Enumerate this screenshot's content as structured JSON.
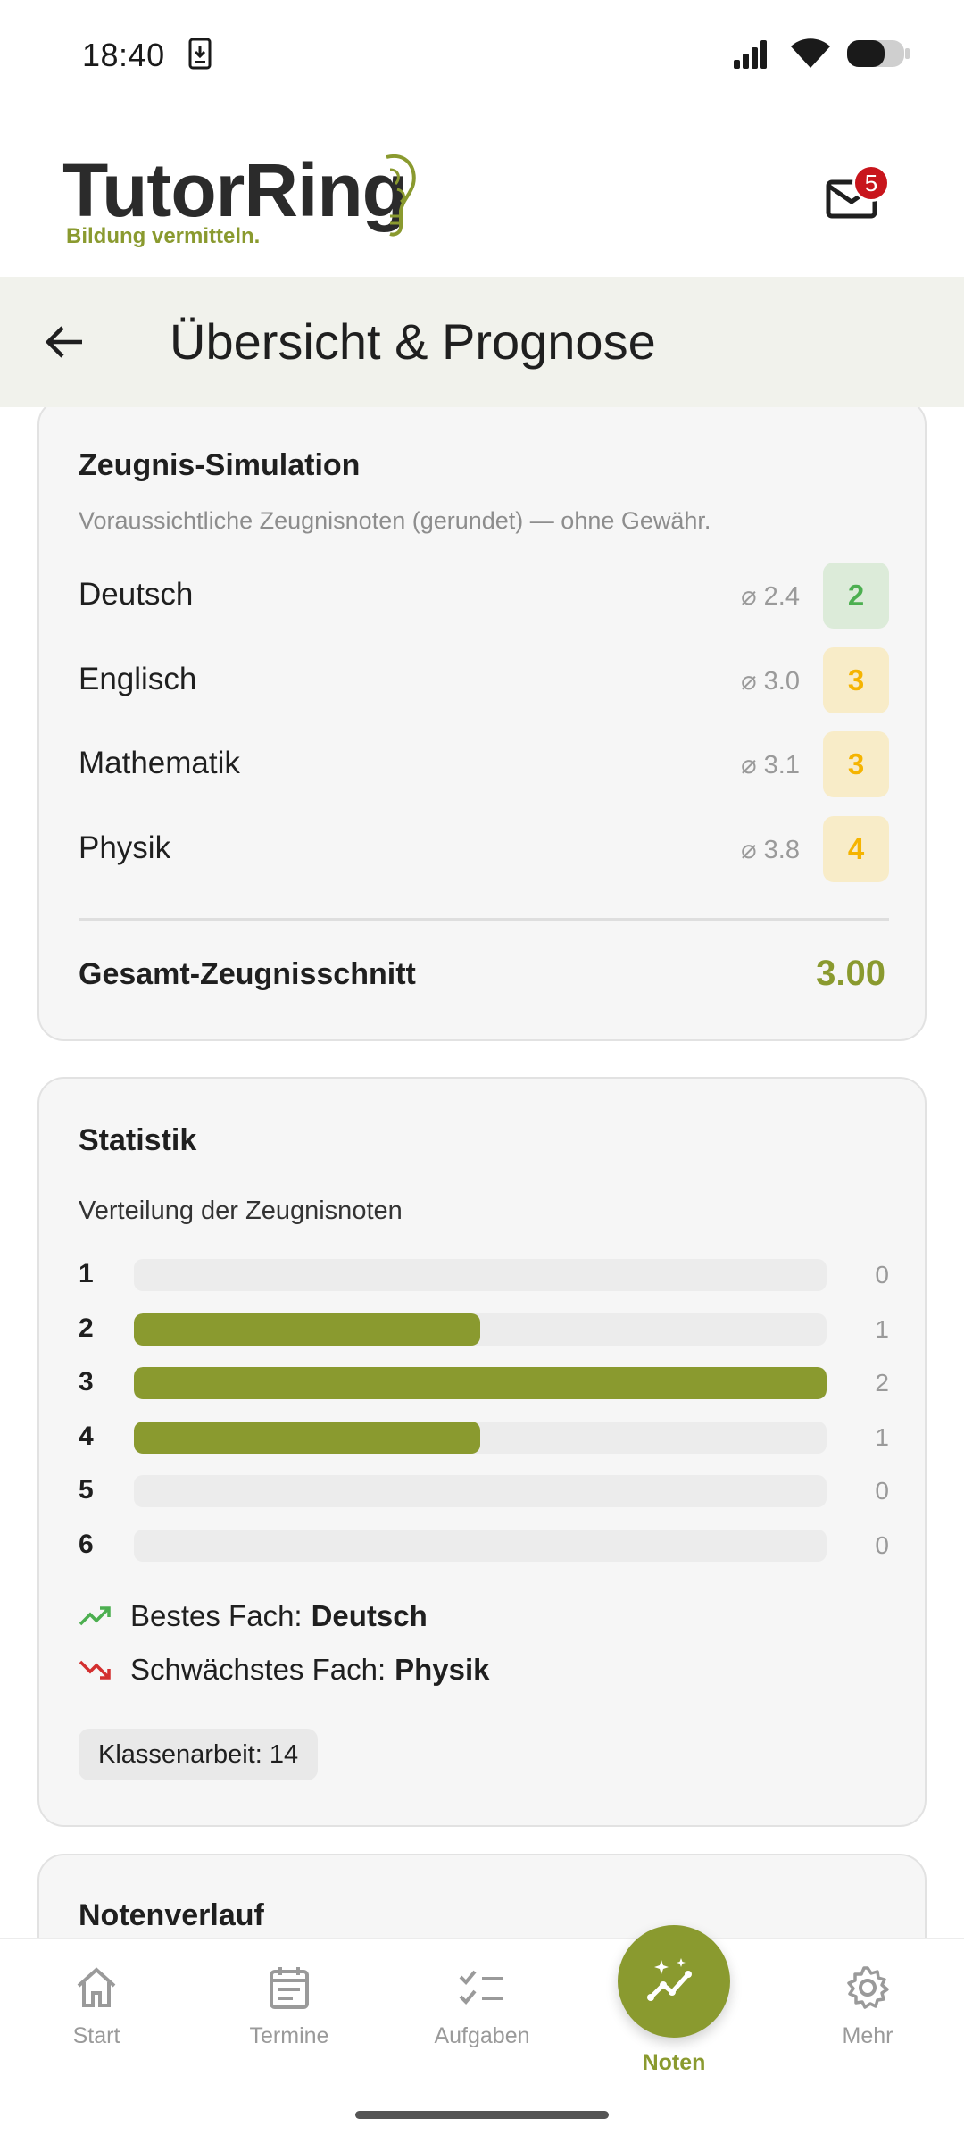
{
  "status_bar": {
    "time": "18:40"
  },
  "header": {
    "logo_title": "TutorRing",
    "logo_subtitle": "Bildung vermitteln.",
    "mail_badge": "5"
  },
  "title_bar": {
    "title": "Übersicht & Prognose"
  },
  "simulation": {
    "title": "Zeugnis-Simulation",
    "subtitle": "Voraussichtliche Zeugnisnoten (gerundet) — ohne Gewähr.",
    "subjects": [
      {
        "name": "Deutsch",
        "avg": "⌀ 2.4",
        "grade": "2"
      },
      {
        "name": "Englisch",
        "avg": "⌀ 3.0",
        "grade": "3"
      },
      {
        "name": "Mathematik",
        "avg": "⌀ 3.1",
        "grade": "3"
      },
      {
        "name": "Physik",
        "avg": "⌀ 3.8",
        "grade": "4"
      }
    ],
    "total_label": "Gesamt-Zeugnisschnitt",
    "total_value": "3.00"
  },
  "statistics": {
    "title": "Statistik",
    "distribution_label": "Verteilung der Zeugnisnoten",
    "distribution": [
      {
        "grade": "1",
        "count": 0
      },
      {
        "grade": "2",
        "count": 1
      },
      {
        "grade": "3",
        "count": 2
      },
      {
        "grade": "4",
        "count": 1
      },
      {
        "grade": "5",
        "count": 0
      },
      {
        "grade": "6",
        "count": 0
      }
    ],
    "best_label": "Bestes Fach:",
    "best_value": "Deutsch",
    "worst_label": "Schwächstes Fach:",
    "worst_value": "Physik",
    "chip": "Klassenarbeit: 14"
  },
  "trend": {
    "title": "Notenverlauf"
  },
  "bottom_nav": {
    "items": [
      {
        "label": "Start",
        "icon": "home-icon"
      },
      {
        "label": "Termine",
        "icon": "calendar-icon"
      },
      {
        "label": "Aufgaben",
        "icon": "checklist-icon"
      },
      {
        "label": "Noten",
        "icon": "trend-sparkle-icon",
        "active": true
      },
      {
        "label": "Mehr",
        "icon": "gear-icon"
      }
    ]
  },
  "colors": {
    "accent": "#8a9a2f",
    "badge_green_bg": "#dcebd9",
    "badge_green_fg": "#4caf50",
    "badge_yellow_bg": "#f8ecc8",
    "badge_yellow_fg": "#f5b400",
    "title_bar_bg": "#f1f2ec",
    "notification_red": "#c8151c"
  }
}
